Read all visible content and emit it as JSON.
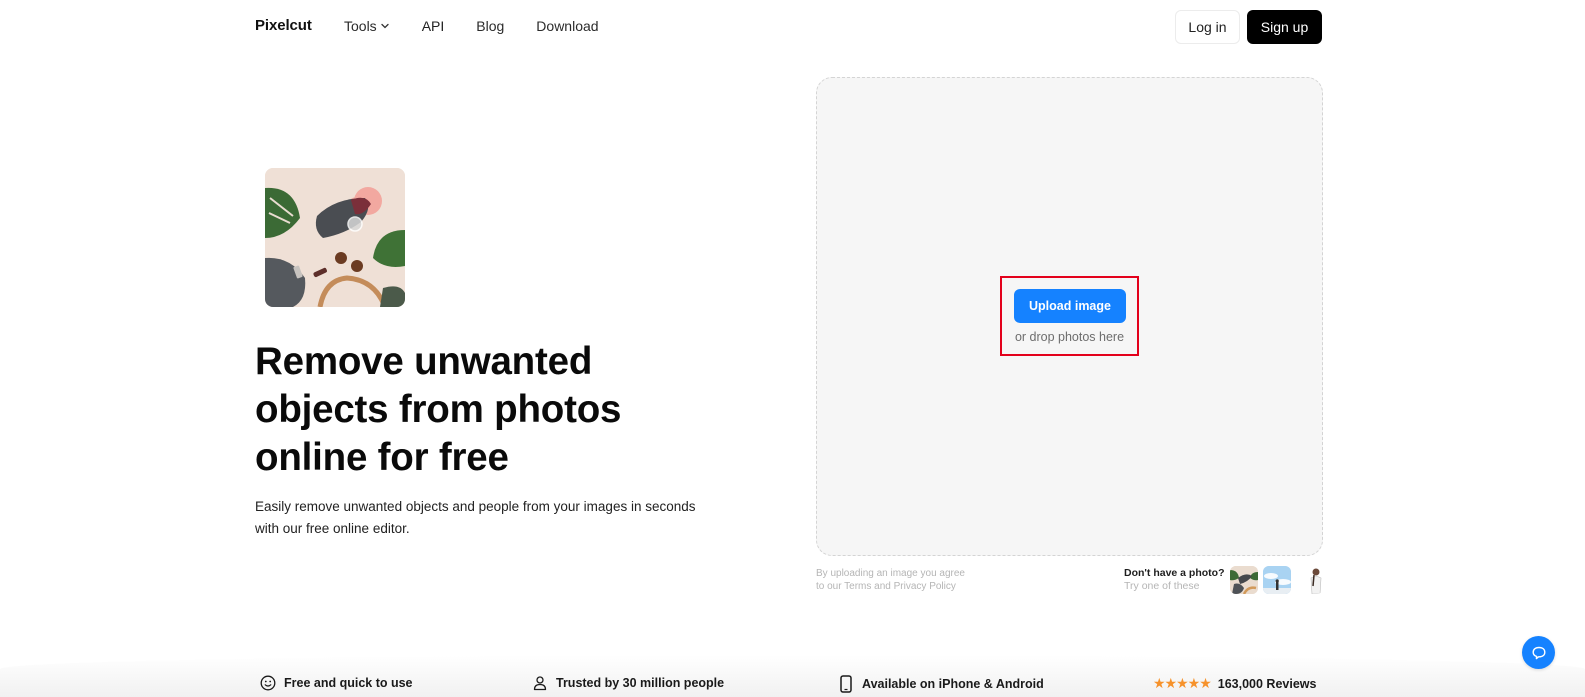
{
  "header": {
    "brand": "Pixelcut",
    "nav": [
      {
        "label": "Tools",
        "has_dropdown": true
      },
      {
        "label": "API"
      },
      {
        "label": "Blog"
      },
      {
        "label": "Download"
      }
    ],
    "login_label": "Log in",
    "signup_label": "Sign up"
  },
  "hero": {
    "thumbnail_icon": "product-flatlay-image",
    "title": "Remove unwanted objects from photos online for free",
    "subtitle": "Easily remove unwanted objects and people from your images in seconds with our free online editor."
  },
  "upload": {
    "button_label": "Upload image",
    "drop_text": "or drop photos here",
    "terms_line1": "By uploading an image you agree",
    "terms_line2": "to our Terms and Privacy Policy",
    "samples_title": "Don't have a photo?",
    "samples_subtitle": "Try one of these",
    "samples": [
      "sample-flatlay",
      "sample-sky-person",
      "sample-woman"
    ]
  },
  "features": [
    {
      "icon": "smiley-icon",
      "label": "Free and quick to use"
    },
    {
      "icon": "user-icon",
      "label": "Trusted by 30 million people"
    },
    {
      "icon": "phone-icon",
      "label": "Available on iPhone & Android"
    },
    {
      "icon": "stars-icon",
      "label": "163,000 Reviews",
      "rating": 5,
      "stars": "★★★★★"
    }
  ],
  "colors": {
    "accent": "#1582ff",
    "highlight": "#e3001b",
    "star": "#f6922b"
  },
  "chat": {
    "icon": "chat-icon"
  }
}
